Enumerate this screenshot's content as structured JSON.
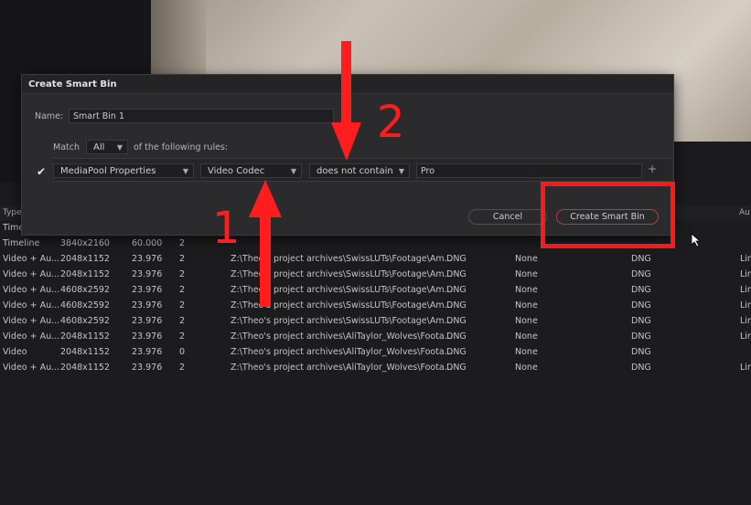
{
  "dialog": {
    "title": "Create Smart Bin",
    "name_label": "Name:",
    "name_value": "Smart Bin 1",
    "match_label": "Match",
    "match_value": "All",
    "rules_suffix": "of the following rules:",
    "rule": {
      "enabled": true,
      "field": "MediaPool Properties",
      "property": "Video Codec",
      "operator": "does not contain",
      "value": "Pro"
    },
    "cancel_label": "Cancel",
    "create_label": "Create Smart Bin"
  },
  "annotations": {
    "arrow1_label": "1",
    "arrow2_label": "2",
    "highlight_color": "#ff1818"
  },
  "media_pool": {
    "headers": {
      "type": "Type",
      "audio": "Au"
    },
    "partial_row": "Time",
    "rows": [
      {
        "type": "Timeline",
        "res": "3840x2160",
        "fps": "60.000",
        "n": "2",
        "path": "",
        "codec": "",
        "none": "",
        "fmt": "",
        "lin": ""
      },
      {
        "type": "Video + Au...",
        "res": "2048x1152",
        "fps": "23.976",
        "n": "2",
        "path": "Z:\\Theo's project archives\\SwissLUTs\\Footage\\Am...",
        "codec": "DNG",
        "none": "None",
        "fmt": "DNG",
        "lin": "Lin"
      },
      {
        "type": "Video + Au...",
        "res": "2048x1152",
        "fps": "23.976",
        "n": "2",
        "path": "Z:\\Theo's project archives\\SwissLUTs\\Footage\\Am...",
        "codec": "DNG",
        "none": "None",
        "fmt": "DNG",
        "lin": "Lin"
      },
      {
        "type": "Video + Au...",
        "res": "4608x2592",
        "fps": "23.976",
        "n": "2",
        "path": "Z:\\Theo's project archives\\SwissLUTs\\Footage\\Am...",
        "codec": "DNG",
        "none": "None",
        "fmt": "DNG",
        "lin": "Lin"
      },
      {
        "type": "Video + Au...",
        "res": "4608x2592",
        "fps": "23.976",
        "n": "2",
        "path": "Z:\\Theo's project archives\\SwissLUTs\\Footage\\Am...",
        "codec": "DNG",
        "none": "None",
        "fmt": "DNG",
        "lin": "Lin"
      },
      {
        "type": "Video + Au...",
        "res": "4608x2592",
        "fps": "23.976",
        "n": "2",
        "path": "Z:\\Theo's project archives\\SwissLUTs\\Footage\\Am...",
        "codec": "DNG",
        "none": "None",
        "fmt": "DNG",
        "lin": "Lin"
      },
      {
        "type": "Video + Au...",
        "res": "2048x1152",
        "fps": "23.976",
        "n": "2",
        "path": "Z:\\Theo's project archives\\AliTaylor_Wolves\\Foota...",
        "codec": "DNG",
        "none": "None",
        "fmt": "DNG",
        "lin": "Lin"
      },
      {
        "type": "Video",
        "res": "2048x1152",
        "fps": "23.976",
        "n": "0",
        "path": "Z:\\Theo's project archives\\AliTaylor_Wolves\\Foota...",
        "codec": "DNG",
        "none": "None",
        "fmt": "DNG",
        "lin": ""
      },
      {
        "type": "Video + Au...",
        "res": "2048x1152",
        "fps": "23.976",
        "n": "2",
        "path": "Z:\\Theo's project archives\\AliTaylor_Wolves\\Foota...",
        "codec": "DNG",
        "none": "None",
        "fmt": "DNG",
        "lin": "Lin"
      }
    ]
  }
}
